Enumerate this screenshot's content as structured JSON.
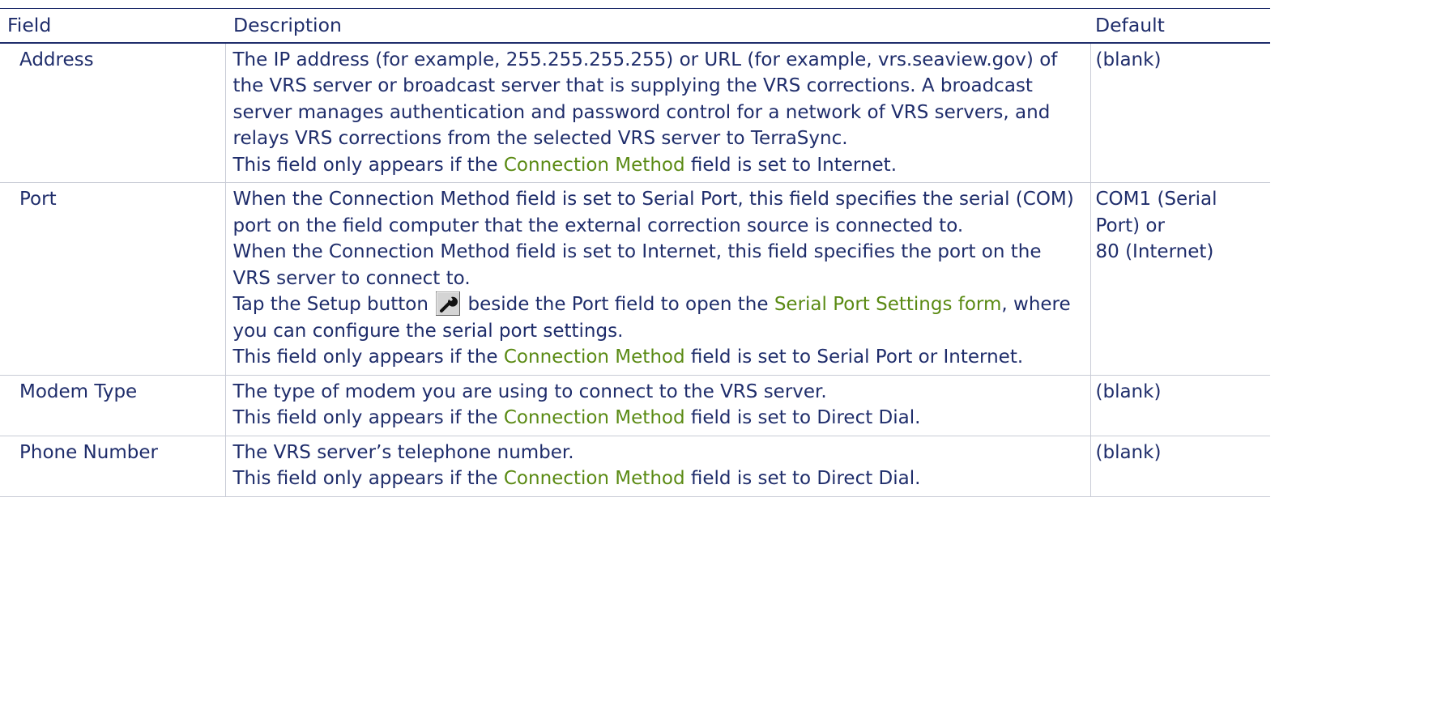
{
  "table": {
    "headers": {
      "field": "Field",
      "description": "Description",
      "default": "Default"
    },
    "rows": [
      {
        "field": "Address",
        "description": {
          "p1": "The IP address (for example, 255.255.255.255) or URL (for example, vrs.seaview.gov) of the VRS server or broadcast server that is supplying the VRS corrections. A broadcast server manages authentication and password control for a network of VRS servers, and relays VRS corrections from the selected VRS server to TerraSync.",
          "note_pre": "This field only appears if the ",
          "note_link": "Connection Method",
          "note_post": " field is set to Internet."
        },
        "default": "(blank)"
      },
      {
        "field": "Port",
        "description": {
          "p1": "When the Connection Method field is set to Serial Port, this field specifies the serial (COM) port on the field computer that the external correction source is connected to.",
          "p2": "When the Connection Method field is set to Internet, this field specifies the port on the VRS server to connect to.",
          "setup_pre": "Tap the Setup button ",
          "setup_icon": "wrench-icon",
          "setup_mid": " beside the Port field to open the ",
          "setup_link": "Serial Port Settings form",
          "setup_post": ", where you can configure the serial port settings.",
          "note_pre": "This field only appears if the ",
          "note_link": "Connection Method",
          "note_post": " field is set to Serial Port or Internet."
        },
        "default_lines": [
          "COM1 (Serial",
          "Port) or",
          "80 (Internet)"
        ]
      },
      {
        "field": "Modem Type",
        "description": {
          "p1": "The type of modem you are using to connect to the VRS server.",
          "note_pre": "This field only appears if the ",
          "note_link": "Connection Method",
          "note_post": " field is set to Direct Dial."
        },
        "default": "(blank)"
      },
      {
        "field": "Phone Number",
        "description": {
          "p1": "The VRS server’s telephone number.",
          "note_pre": "This field only appears if the ",
          "note_link": "Connection Method",
          "note_post": " field is set to Direct Dial."
        },
        "default": "(blank)"
      }
    ]
  },
  "colors": {
    "text": "#1f2d6b",
    "link": "#5a8a13",
    "rule": "#c9ccd6"
  }
}
